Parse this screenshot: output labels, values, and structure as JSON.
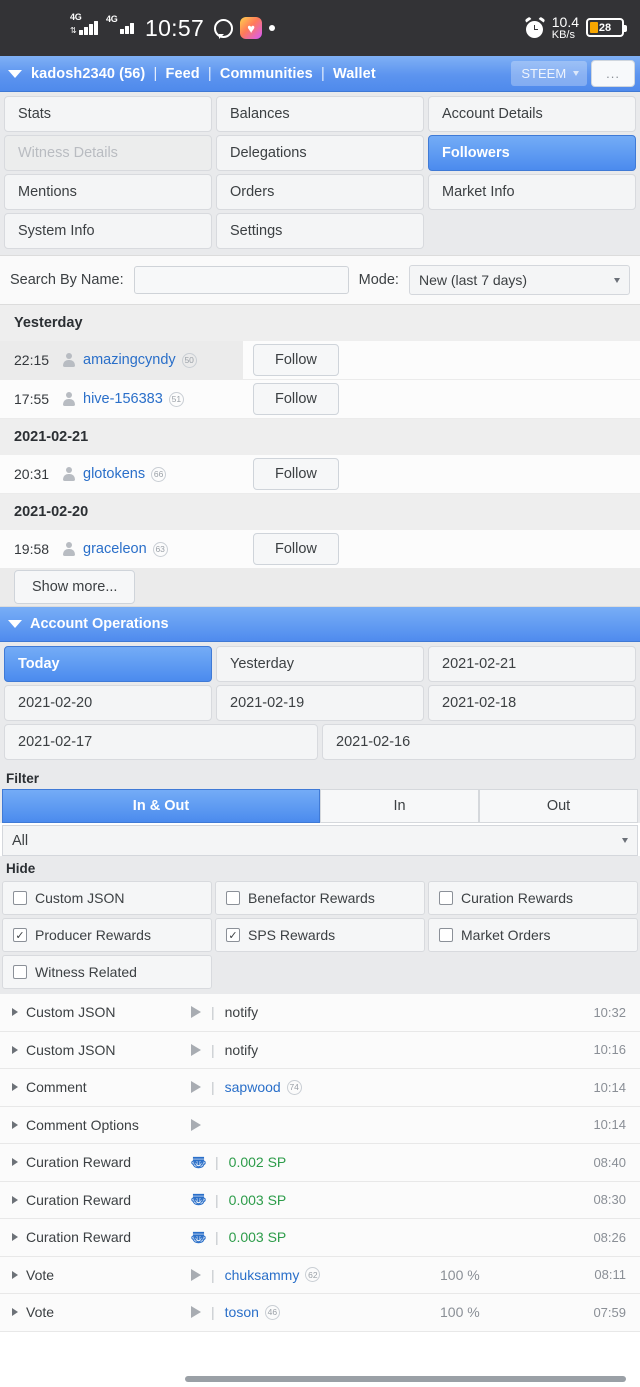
{
  "statusbar": {
    "network_1": "4G",
    "network_2": "4G",
    "time": "10:57",
    "net_speed_value": "10.4",
    "net_speed_unit": "KB/s",
    "battery_level": "28",
    "battery_percent": 28,
    "battery_color": "#f7a600"
  },
  "header": {
    "account": "kadosh2340 (56)",
    "nav_feed": "Feed",
    "nav_communities": "Communities",
    "nav_wallet": "Wallet",
    "separator": "|",
    "chain_selector": "STEEM",
    "more_button": "..."
  },
  "tabs": [
    [
      {
        "label": "Stats",
        "state": "normal"
      },
      {
        "label": "Balances",
        "state": "normal"
      },
      {
        "label": "Account Details",
        "state": "normal"
      }
    ],
    [
      {
        "label": "Witness Details",
        "state": "disabled"
      },
      {
        "label": "Delegations",
        "state": "normal"
      },
      {
        "label": "Followers",
        "state": "active"
      }
    ],
    [
      {
        "label": "Mentions",
        "state": "normal"
      },
      {
        "label": "Orders",
        "state": "normal"
      },
      {
        "label": "Market Info",
        "state": "normal"
      }
    ],
    [
      {
        "label": "System Info",
        "state": "normal"
      },
      {
        "label": "Settings",
        "state": "normal"
      },
      {
        "label": "",
        "state": "blank"
      }
    ]
  ],
  "search": {
    "label": "Search By Name:",
    "value": "",
    "placeholder": "",
    "mode_label": "Mode:",
    "mode_value": "New (last 7 days)"
  },
  "followers": {
    "groups": [
      {
        "date": "Yesterday",
        "rows": [
          {
            "time": "22:15",
            "user": "amazingcyndy",
            "rep": "50",
            "action": "Follow",
            "highlight": true
          },
          {
            "time": "17:55",
            "user": "hive-156383",
            "rep": "51",
            "action": "Follow",
            "highlight": false
          }
        ]
      },
      {
        "date": "2021-02-21",
        "rows": [
          {
            "time": "20:31",
            "user": "glotokens",
            "rep": "66",
            "action": "Follow",
            "highlight": false
          }
        ]
      },
      {
        "date": "2021-02-20",
        "rows": [
          {
            "time": "19:58",
            "user": "graceleon",
            "rep": "63",
            "action": "Follow",
            "highlight": false
          }
        ]
      }
    ],
    "show_more": "Show more..."
  },
  "operations": {
    "title": "Account Operations",
    "date_tabs": [
      [
        {
          "label": "Today",
          "active": true
        },
        {
          "label": "Yesterday",
          "active": false
        },
        {
          "label": "2021-02-21",
          "active": false
        }
      ],
      [
        {
          "label": "2021-02-20",
          "active": false
        },
        {
          "label": "2021-02-19",
          "active": false
        },
        {
          "label": "2021-02-18",
          "active": false
        }
      ],
      [
        {
          "label": "2021-02-17",
          "active": false
        },
        {
          "label": "2021-02-16",
          "active": false
        }
      ]
    ],
    "filter_label": "Filter",
    "segments": [
      {
        "label": "In & Out",
        "active": true
      },
      {
        "label": "In",
        "active": false
      },
      {
        "label": "Out",
        "active": false
      }
    ],
    "type_filter": "All",
    "hide_label": "Hide",
    "hide_options": [
      [
        {
          "label": "Custom JSON",
          "checked": false
        },
        {
          "label": "Benefactor Rewards",
          "checked": false
        },
        {
          "label": "Curation Rewards",
          "checked": false
        }
      ],
      [
        {
          "label": "Producer Rewards",
          "checked": true
        },
        {
          "label": "SPS Rewards",
          "checked": true
        },
        {
          "label": "Market Orders",
          "checked": false
        }
      ],
      [
        {
          "label": "Witness Related",
          "checked": false
        }
      ]
    ],
    "rows": [
      {
        "name": "Custom JSON",
        "icon": "play-triangle",
        "value": "notify",
        "value_style": "plain",
        "pct": "",
        "time": "10:32"
      },
      {
        "name": "Custom JSON",
        "icon": "play-triangle",
        "value": "notify",
        "value_style": "plain",
        "pct": "",
        "time": "10:16"
      },
      {
        "name": "Comment",
        "icon": "play-triangle",
        "value": "sapwood",
        "value_style": "link",
        "rep": "74",
        "pct": "",
        "time": "10:14"
      },
      {
        "name": "Comment Options",
        "icon": "play-triangle",
        "value": "",
        "value_style": "plain",
        "pct": "",
        "time": "10:14"
      },
      {
        "name": "Curation Reward",
        "icon": "steem-logo",
        "value": "0.002 SP",
        "value_style": "green",
        "pct": "",
        "time": "08:40"
      },
      {
        "name": "Curation Reward",
        "icon": "steem-logo",
        "value": "0.003 SP",
        "value_style": "green",
        "pct": "",
        "time": "08:30"
      },
      {
        "name": "Curation Reward",
        "icon": "steem-logo",
        "value": "0.003 SP",
        "value_style": "green",
        "pct": "",
        "time": "08:26"
      },
      {
        "name": "Vote",
        "icon": "play-triangle",
        "value": "chuksammy",
        "value_style": "link",
        "rep": "62",
        "pct": "100 %",
        "time": "08:11"
      },
      {
        "name": "Vote",
        "icon": "play-triangle",
        "value": "toson",
        "value_style": "link",
        "rep": "46",
        "pct": "100 %",
        "time": "07:59"
      }
    ]
  },
  "colors": {
    "accent_blue": "#4f8bee",
    "link_blue": "#2a6fc9",
    "amount_green": "#2d9c4a",
    "status_bg": "#333336"
  }
}
